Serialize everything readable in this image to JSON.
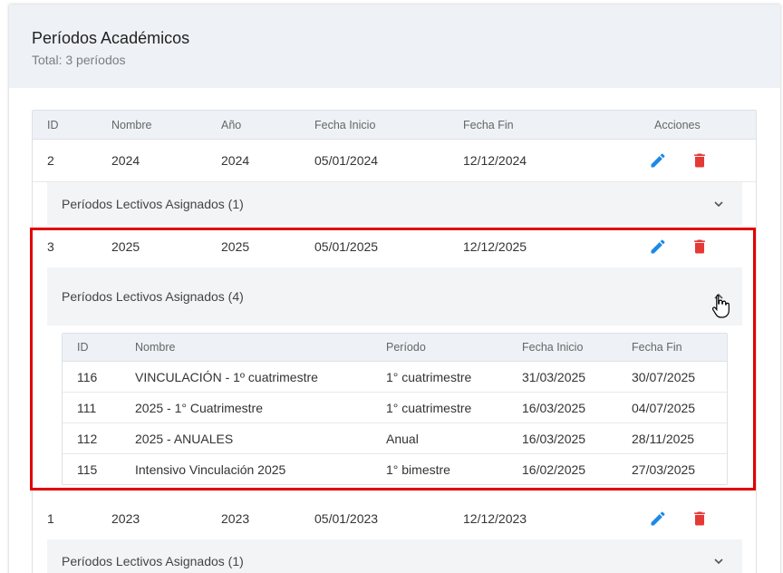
{
  "header": {
    "title": "Períodos Académicos",
    "subtitle": "Total: 3 períodos"
  },
  "columns": [
    "ID",
    "Nombre",
    "Año",
    "Fecha Inicio",
    "Fecha Fin",
    "Acciones"
  ],
  "rows": [
    {
      "id": "2",
      "nombre": "2024",
      "anio": "2024",
      "fecha_inicio": "05/01/2024",
      "fecha_fin": "12/12/2024",
      "expander": "Períodos Lectivos Asignados (1)",
      "expanded": false
    },
    {
      "id": "3",
      "nombre": "2025",
      "anio": "2025",
      "fecha_inicio": "05/01/2025",
      "fecha_fin": "12/12/2025",
      "expander": "Períodos Lectivos Asignados (4)",
      "expanded": true,
      "sub_columns": [
        "ID",
        "Nombre",
        "Período",
        "Fecha Inicio",
        "Fecha Fin"
      ],
      "sub_rows": [
        {
          "id": "116",
          "nombre": "VINCULACIÓN - 1º cuatrimestre",
          "periodo": "1° cuatrimestre",
          "fecha_inicio": "31/03/2025",
          "fecha_fin": "30/07/2025"
        },
        {
          "id": "111",
          "nombre": "2025 - 1° Cuatrimestre",
          "periodo": "1° cuatrimestre",
          "fecha_inicio": "16/03/2025",
          "fecha_fin": "04/07/2025"
        },
        {
          "id": "112",
          "nombre": "2025 - ANUALES",
          "periodo": "Anual",
          "fecha_inicio": "16/03/2025",
          "fecha_fin": "28/11/2025"
        },
        {
          "id": "115",
          "nombre": "Intensivo Vinculación 2025",
          "periodo": "1° bimestre",
          "fecha_inicio": "16/02/2025",
          "fecha_fin": "27/03/2025"
        }
      ]
    },
    {
      "id": "1",
      "nombre": "2023",
      "anio": "2023",
      "fecha_inicio": "05/01/2023",
      "fecha_fin": "12/12/2023",
      "expander": "Períodos Lectivos Asignados (1)",
      "expanded": false
    }
  ],
  "icons": {
    "edit": "pencil-icon",
    "delete": "trash-icon",
    "expand": "chevron-down-icon",
    "collapse": "chevron-up-icon"
  },
  "colors": {
    "edit": "#1e88e5",
    "delete": "#e53935",
    "highlight": "#e00000",
    "header_bg": "#eef1f5"
  }
}
